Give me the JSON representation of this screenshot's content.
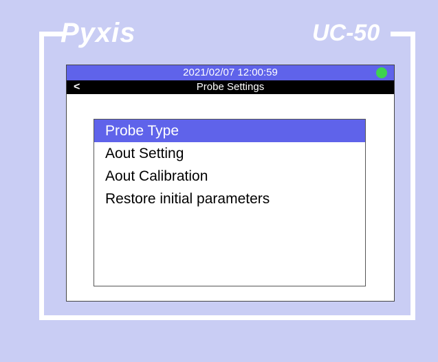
{
  "device": {
    "brand": "Pyxis",
    "model": "UC-50"
  },
  "status_bar": {
    "datetime": "2021/02/07  12:00:59",
    "indicator_color": "#3ed34f"
  },
  "title_bar": {
    "back_label": "<",
    "title": "Probe Settings"
  },
  "menu": {
    "items": [
      {
        "label": "Probe Type",
        "selected": true
      },
      {
        "label": "Aout Setting",
        "selected": false
      },
      {
        "label": "Aout Calibration",
        "selected": false
      },
      {
        "label": "Restore initial parameters",
        "selected": false
      }
    ]
  },
  "colors": {
    "background": "#c9cdf4",
    "accent": "#5f63ea",
    "title_bar": "#000000"
  }
}
